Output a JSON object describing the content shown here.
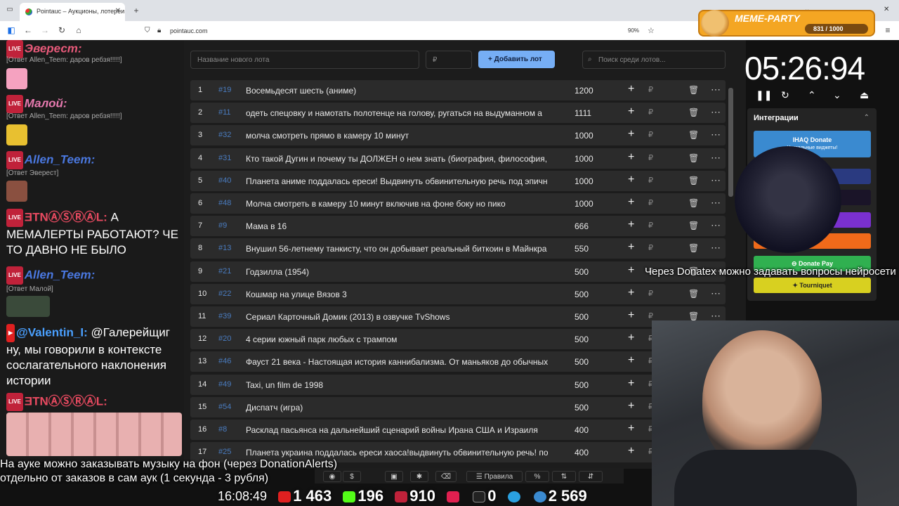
{
  "browser": {
    "tab_title": "Pointauc – Аукционы, лотереи",
    "url": "pointauc.com",
    "zoom": "90%"
  },
  "meme_party": {
    "title": "MEME-PARTY",
    "counter": "831 / 1000"
  },
  "chat": {
    "m1_user": "Эверест:",
    "m1_reply": "[Ответ Allen_Teem: даров ребзя!!!!!]",
    "m2_user": "Малой:",
    "m2_reply": "[Ответ Allen_Teem: даров ребзя!!!!!]",
    "m3_user": "Allen_Teem:",
    "m3_reply": "[Ответ Эверест]",
    "m4_user": "ƎTNⒶⓈⓇⒶL:",
    "m4_text": "А МЕМАЛЕРТЫ РАБОТАЮТ? ЧЕ ТО ДАВНО НЕ БЫЛО",
    "m5_user": "Allen_Teem:",
    "m5_reply": "[Ответ Малой]",
    "m6_user": "@Valentin_I:",
    "m6_text": "@Галерейщиг ну, мы говорили в контексте сослагательного наклонения истории",
    "m7_user": "ƎTNⒶⓈⓇⒶL:"
  },
  "toolbar": {
    "new_lot_placeholder": "Название нового лота",
    "amount_placeholder": "₽",
    "add_button": "Добавить лот",
    "search_placeholder": "Поиск среди лотов..."
  },
  "lots": [
    {
      "n": "1",
      "id": "#19",
      "name": "Восемьдесят шесть (аниме)",
      "amount": "1200"
    },
    {
      "n": "2",
      "id": "#11",
      "name": "одеть спецовку и намотать полотенце на голову, ругаться на выдуманном а",
      "amount": "1111"
    },
    {
      "n": "3",
      "id": "#32",
      "name": "молча смотреть прямо в камеру 10 минут",
      "amount": "1000"
    },
    {
      "n": "4",
      "id": "#31",
      "name": "Кто такой Дугин и почему ты ДОЛЖЕН о нем знать (биография, философия,",
      "amount": "1000"
    },
    {
      "n": "5",
      "id": "#40",
      "name": "Планета аниме поддалась ереси! Выдвинуть обвинительную речь под эпичн",
      "amount": "1000"
    },
    {
      "n": "6",
      "id": "#48",
      "name": "Молча смотреть в камеру 10 минут включив на фоне боку но пико",
      "amount": "1000"
    },
    {
      "n": "7",
      "id": "#9",
      "name": "Мама в 16",
      "amount": "666"
    },
    {
      "n": "8",
      "id": "#13",
      "name": "Внушил 56-летнему танкисту, что он добывает реальный биткоин в Майнкра",
      "amount": "550"
    },
    {
      "n": "9",
      "id": "#21",
      "name": "Годзилла (1954)",
      "amount": "500"
    },
    {
      "n": "10",
      "id": "#22",
      "name": "Кошмар на улице Вязов 3",
      "amount": "500"
    },
    {
      "n": "11",
      "id": "#39",
      "name": "Сериал Карточный Домик (2013) в озвучке TvShows",
      "amount": "500"
    },
    {
      "n": "12",
      "id": "#20",
      "name": "4 серии южный парк любых с трампом",
      "amount": "500"
    },
    {
      "n": "13",
      "id": "#46",
      "name": "Фауст 21 века - Настоящая история каннибализма. От маньяков до обычных",
      "amount": "500"
    },
    {
      "n": "14",
      "id": "#49",
      "name": "Taxi, un film de 1998",
      "amount": "500"
    },
    {
      "n": "15",
      "id": "#54",
      "name": "Диспатч (игра)",
      "amount": "500"
    },
    {
      "n": "16",
      "id": "#8",
      "name": "Расклад пасьянса на дальнейший сценарий войны Ирана США и Израиля",
      "amount": "400"
    },
    {
      "n": "17",
      "id": "#25",
      "name": "Планета украина поддалась ереси хаоса!выдвинуть обвинительную речь! по",
      "amount": "400"
    }
  ],
  "timer": {
    "value": "05:26:94"
  },
  "integrations": {
    "title": "Интеграции",
    "donate_top": "IHAQ Donate",
    "donate_sub": "Уникальные виджеты!",
    "ter": "ter",
    "alerts": "lerts",
    "donate_pay": "Donate Pay",
    "tourniquet": "Tourniquet"
  },
  "overlays": {
    "donatex": "Через Donatex можно задавать вопросы нейросети",
    "music1": "На ауке можно заказывать музыку на фон (через DonationAlerts)",
    "music2": "отдельно от заказов в сам аук (1 секунда - 3 рубля)"
  },
  "bottom": {
    "rules": "Правила",
    "dollar": "$",
    "percent": "%"
  },
  "stats": {
    "time": "16:08:49",
    "youtube": "1 463",
    "kick": "196",
    "vk": "910",
    "rumble": "0",
    "telegram": "",
    "viewers": "2 569"
  }
}
